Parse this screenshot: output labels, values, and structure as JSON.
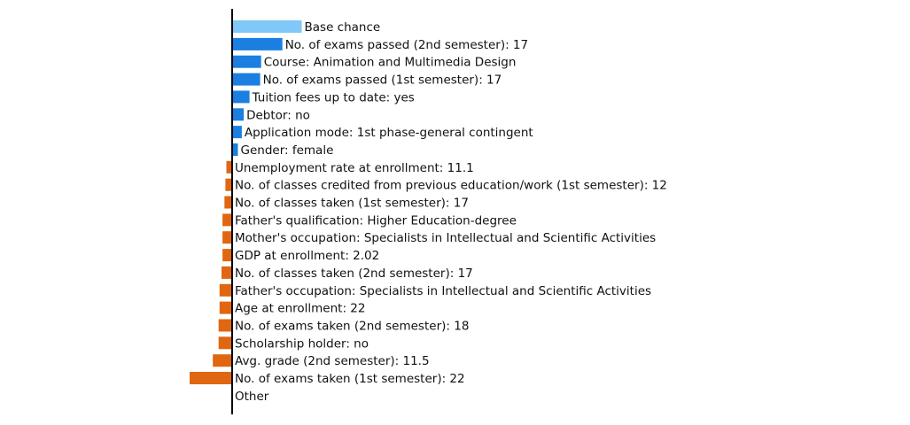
{
  "chart_data": {
    "type": "bar",
    "orientation": "horizontal",
    "title": "",
    "xlabel": "",
    "ylabel": "",
    "baseline": 0,
    "grid": false,
    "xlim": [
      -1.2,
      1.9
    ],
    "colors": {
      "base": "#7fc8f8",
      "positive": "#1a7fe0",
      "negative": "#e06611",
      "axis": "#000000"
    },
    "bars": [
      {
        "label": "Base chance",
        "value": 0.36,
        "kind": "base"
      },
      {
        "label": "No. of exams passed (2nd semester): 17",
        "value": 0.26,
        "kind": "positive"
      },
      {
        "label": "Course: Animation and Multimedia Design",
        "value": 0.15,
        "kind": "positive"
      },
      {
        "label": "No. of exams passed (1st semester): 17",
        "value": 0.145,
        "kind": "positive"
      },
      {
        "label": "Tuition fees up to date: yes",
        "value": 0.09,
        "kind": "positive"
      },
      {
        "label": "Debtor: no",
        "value": 0.06,
        "kind": "positive"
      },
      {
        "label": "Application mode: 1st phase-general contingent",
        "value": 0.05,
        "kind": "positive"
      },
      {
        "label": "Gender: female",
        "value": 0.03,
        "kind": "positive"
      },
      {
        "label": "Unemployment rate at enrollment: 11.1",
        "value": -0.03,
        "kind": "negative"
      },
      {
        "label": "No. of classes credited from previous education/work (1st semester): 12",
        "value": -0.035,
        "kind": "negative"
      },
      {
        "label": "No. of classes taken (1st semester): 17",
        "value": -0.04,
        "kind": "negative"
      },
      {
        "label": "Father's qualification: Higher Education-degree",
        "value": -0.05,
        "kind": "negative"
      },
      {
        "label": "Mother's occupation: Specialists in Intellectual and Scientific Activities",
        "value": -0.05,
        "kind": "negative"
      },
      {
        "label": "GDP at enrollment: 2.02",
        "value": -0.05,
        "kind": "negative"
      },
      {
        "label": "No. of classes taken (2nd semester): 17",
        "value": -0.055,
        "kind": "negative"
      },
      {
        "label": "Father's occupation: Specialists in Intellectual and Scientific Activities",
        "value": -0.065,
        "kind": "negative"
      },
      {
        "label": "Age at enrollment: 22",
        "value": -0.065,
        "kind": "negative"
      },
      {
        "label": "No. of exams taken (2nd semester): 18",
        "value": -0.07,
        "kind": "negative"
      },
      {
        "label": "Scholarship holder: no",
        "value": -0.07,
        "kind": "negative"
      },
      {
        "label": "Avg. grade (2nd semester): 11.5",
        "value": -0.1,
        "kind": "negative"
      },
      {
        "label": "No. of exams taken (1st semester): 22",
        "value": -0.22,
        "kind": "negative"
      },
      {
        "label": "Other",
        "value": 0,
        "kind": "negative"
      }
    ]
  }
}
